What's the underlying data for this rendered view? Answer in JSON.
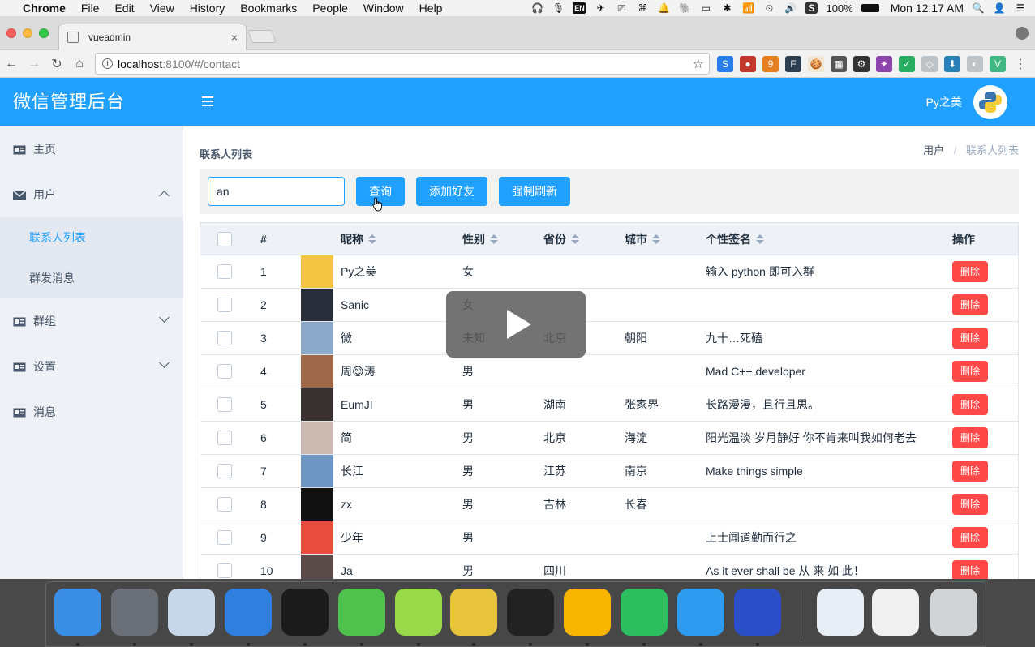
{
  "menubar": {
    "apple": "",
    "items": [
      "Chrome",
      "File",
      "Edit",
      "View",
      "History",
      "Bookmarks",
      "People",
      "Window",
      "Help"
    ],
    "tray": [
      "🎧",
      "🎙",
      "EN",
      "✈",
      "⎚",
      "⌘",
      "🔔",
      "🐘",
      "▭",
      "✱",
      "📶",
      "⏲",
      "🔊",
      "S"
    ],
    "battery": "100%",
    "clock": "Mon 12:17 AM",
    "search_glyph": "🔍",
    "user_glyph": "👤",
    "list_glyph": "☰"
  },
  "browser": {
    "tab_title": "vueadmin",
    "tab_close": "×",
    "url_host": "localhost",
    "url_rest": ":8100/#/contact",
    "info_glyph": "i",
    "star_glyph": "☆",
    "back_glyph": "←",
    "forward_glyph": "→",
    "reload_glyph": "↻",
    "home_glyph": "⌂",
    "menu_glyph": "⋮",
    "extensions": [
      {
        "glyph": "S",
        "color": "#2b7de9"
      },
      {
        "glyph": "●",
        "color": "#c0392b"
      },
      {
        "glyph": "9",
        "color": "#e67e22"
      },
      {
        "glyph": "F",
        "color": "#2c3e50"
      },
      {
        "glyph": "🍪",
        "color": "#f0e6d2"
      },
      {
        "glyph": "▦",
        "color": "#555555"
      },
      {
        "glyph": "⚙",
        "color": "#333333"
      },
      {
        "glyph": "✦",
        "color": "#8e44ad"
      },
      {
        "glyph": "✓",
        "color": "#27ae60"
      },
      {
        "glyph": "◇",
        "color": "#bdc3c7"
      },
      {
        "glyph": "⬇",
        "color": "#2980b9"
      },
      {
        "glyph": "◐",
        "color": "#bdc3c7"
      },
      {
        "glyph": "V",
        "color": "#41b883"
      }
    ]
  },
  "app": {
    "logo": "微信管理后台",
    "username": "Py之美",
    "sidebar": {
      "home": "主页",
      "users": "用户",
      "users_sub": [
        "联系人列表",
        "群发消息"
      ],
      "groups": "群组",
      "settings": "设置",
      "messages": "消息"
    },
    "page_title": "联系人列表",
    "breadcrumb": {
      "parent": "用户",
      "sep": "/",
      "current": "联系人列表"
    },
    "filter": {
      "search_value": "an",
      "query_label": "查询",
      "add_label": "添加好友",
      "refresh_label": "强制刷新"
    },
    "table": {
      "headers": {
        "idx": "#",
        "name": "昵称",
        "sex": "性别",
        "province": "省份",
        "city": "城市",
        "signature": "个性签名",
        "op": "操作"
      },
      "delete_label": "删除",
      "rows": [
        {
          "idx": "1",
          "name": "Py之美",
          "sex": "女",
          "province": "",
          "city": "",
          "signature": "输入 python 即可入群",
          "thumb": "#f4c542"
        },
        {
          "idx": "2",
          "name": "Sanic",
          "sex": "女",
          "province": "",
          "city": "",
          "signature": "",
          "thumb": "#2a2d3a"
        },
        {
          "idx": "3",
          "name": "微",
          "sex": "未知",
          "province": "北京",
          "city": "朝阳",
          "signature": "九十…死磕",
          "thumb": "#8da9c9"
        },
        {
          "idx": "4",
          "name": "周😊涛",
          "sex": "男",
          "province": "",
          "city": "",
          "signature": "Mad C++ developer",
          "thumb": "#a0684a"
        },
        {
          "idx": "5",
          "name": "EumJI",
          "sex": "男",
          "province": "湖南",
          "city": "张家界",
          "signature": "长路漫漫，且行且思。",
          "thumb": "#3a3230"
        },
        {
          "idx": "6",
          "name": "简",
          "sex": "男",
          "province": "北京",
          "city": "海淀",
          "signature": "阳光温淡 岁月静好 你不肯来叫我如何老去",
          "thumb": "#c9b9b0"
        },
        {
          "idx": "7",
          "name": "长江",
          "sex": "男",
          "province": "江苏",
          "city": "南京",
          "signature": "Make things simple",
          "thumb": "#6f95c4"
        },
        {
          "idx": "8",
          "name": "zx",
          "sex": "男",
          "province": "吉林",
          "city": "长春",
          "signature": "",
          "thumb": "#111111"
        },
        {
          "idx": "9",
          "name": "少年",
          "sex": "男",
          "province": "",
          "city": "",
          "signature": "上士闻道勤而行之",
          "thumb": "#e84d3d"
        },
        {
          "idx": "10",
          "name": "Ja",
          "sex": "男",
          "province": "四川",
          "city": "",
          "signature": "As it ever shall be 从 来 如 此！",
          "thumb": "#5b4b4b"
        }
      ]
    }
  },
  "dock": {
    "apps": [
      {
        "name": "finder",
        "color": "#3a8ee6"
      },
      {
        "name": "launchpad",
        "color": "#6b6f78"
      },
      {
        "name": "mail",
        "color": "#c7d7ea"
      },
      {
        "name": "quicktime",
        "color": "#2f7fe0"
      },
      {
        "name": "qq",
        "color": "#1b1b1b"
      },
      {
        "name": "wechat",
        "color": "#4ec24d"
      },
      {
        "name": "lime",
        "color": "#9ad94a"
      },
      {
        "name": "chrome",
        "color": "#e8c33c"
      },
      {
        "name": "terminal",
        "color": "#222222"
      },
      {
        "name": "sketch",
        "color": "#f7b500"
      },
      {
        "name": "evernote",
        "color": "#2dbe60"
      },
      {
        "name": "safari",
        "color": "#2d9cf0"
      },
      {
        "name": "screenflow",
        "color": "#2b4ec9"
      },
      {
        "name": "doc-preview-1",
        "color": "#e8eef5"
      },
      {
        "name": "doc-preview-2",
        "color": "#f0f0f0"
      },
      {
        "name": "trash",
        "color": "#cfd3d6"
      }
    ]
  }
}
